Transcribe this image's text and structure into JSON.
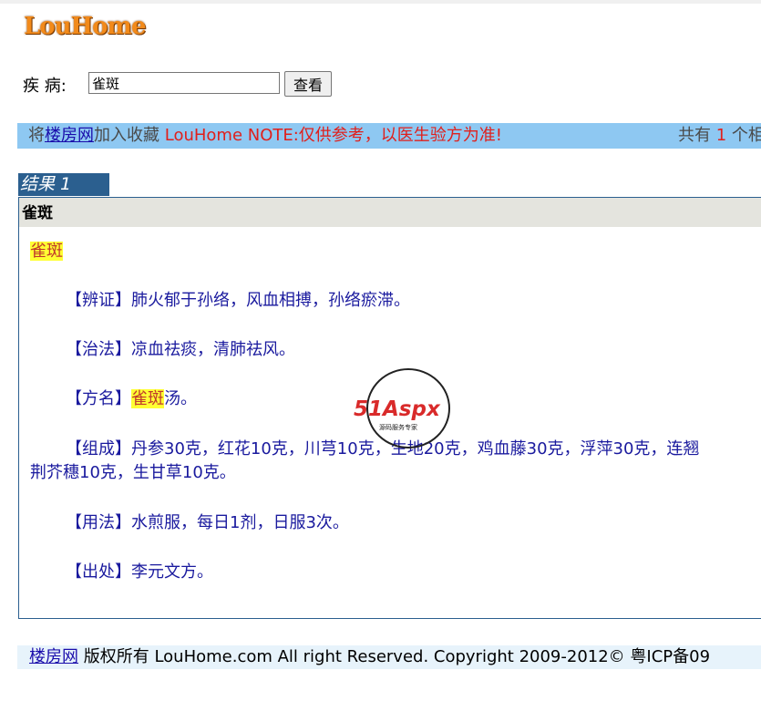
{
  "logo": "LouHome",
  "search": {
    "label": "疾 病:",
    "value": "雀斑",
    "button": "查看"
  },
  "notice": {
    "prefix": "将",
    "link": "楼房网",
    "suffix": "加入收藏 ",
    "note": "LouHome NOTE:仅供参考，以医生验方为准!",
    "count_prefix": "共有 ",
    "count": "1",
    "count_suffix": " 个相"
  },
  "result": {
    "tab": "结果 1",
    "title": "雀斑",
    "keyword": "雀斑",
    "sections": {
      "bianzheng_tag": "【辨证】",
      "bianzheng": "肺火郁于孙络，风血相搏，孙络瘀滞。",
      "zhifa_tag": "【治法】",
      "zhifa": "凉血祛痰，清肺祛风。",
      "fangming_tag": "【方名】",
      "fangming_hl": "雀斑",
      "fangming_rest": "汤。",
      "zucheng_tag": "【组成】",
      "zucheng_line1": "丹参30克，红花10克，川芎10克，生地20克，鸡血藤30克，浮萍30克，连翘",
      "zucheng_line2": "荆芥穗10克，生甘草10克。",
      "yongfa_tag": "【用法】",
      "yongfa": "水煎服，每日1剂，日服3次。",
      "chuchu_tag": "【出处】",
      "chuchu": "李元文方。"
    }
  },
  "watermark": {
    "brand": "51Aspx",
    "sub": "源码服务专家"
  },
  "footer": {
    "link": "楼房网",
    "text": " 版权所有 LouHome.com All right Reserved. Copyright 2009-2012© 粤ICP备09"
  },
  "colors": {
    "notice_bg": "#8ec8f2",
    "tab_bg": "#2b5f8f",
    "header_bg": "#e4e4de",
    "highlight": "#ffff33",
    "note_red": "#e0201c"
  }
}
